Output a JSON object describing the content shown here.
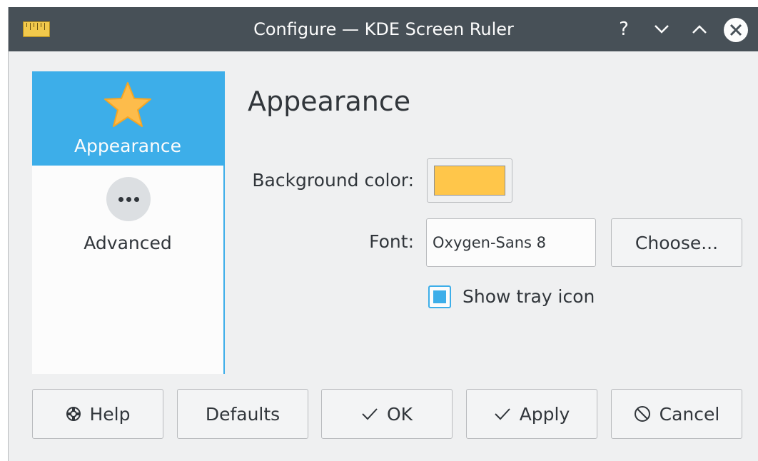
{
  "window": {
    "title": "Configure — KDE Screen Ruler",
    "controls": {
      "help_glyph": "?",
      "minimize_glyph": "⌄",
      "maximize_glyph": "⌃",
      "close_icon": "close-icon"
    }
  },
  "sidebar": {
    "items": [
      {
        "label": "Appearance",
        "icon": "star-icon",
        "selected": true
      },
      {
        "label": "Advanced",
        "icon": "more-dots-icon",
        "selected": false
      }
    ]
  },
  "page": {
    "title": "Appearance",
    "background_color_label": "Background color:",
    "background_color_value": "#ffc64a",
    "font_label": "Font:",
    "font_value": "Oxygen-Sans 8",
    "choose_button": "Choose...",
    "show_tray_icon_label": "Show tray icon",
    "show_tray_icon_checked": true
  },
  "buttons": {
    "help": "Help",
    "defaults": "Defaults",
    "ok": "OK",
    "apply": "Apply",
    "cancel": "Cancel"
  },
  "colors": {
    "accent": "#3daee9",
    "titlebar": "#475057",
    "window_bg": "#eff0f1"
  }
}
